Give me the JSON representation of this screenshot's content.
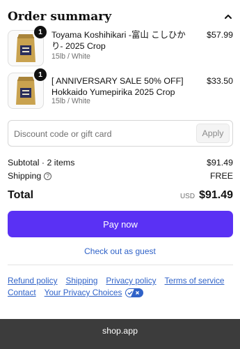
{
  "header": {
    "title": "Order summary",
    "collapse_icon": "chevron-up-icon"
  },
  "items": [
    {
      "name": "Toyama Koshihikari -富山 こしひかり- 2025 Crop",
      "variant": "15lb / White",
      "quantity": "1",
      "price": "$57.99",
      "image": "rice-bag-image"
    },
    {
      "name": "[ ANNIVERSARY SALE 50% OFF] Hokkaido Yumepirika 2025 Crop",
      "variant": "15lb / White",
      "quantity": "1",
      "price": "$33.50",
      "image": "rice-bag-image"
    }
  ],
  "discount": {
    "placeholder": "Discount code or gift card",
    "value": "",
    "apply_label": "Apply"
  },
  "summary": {
    "subtotal_label": "Subtotal · 2 items",
    "subtotal_value": "$91.49",
    "shipping_label": "Shipping",
    "shipping_value": "FREE",
    "total_label": "Total",
    "currency": "USD",
    "total_value": "$91.49"
  },
  "actions": {
    "pay_label": "Pay now",
    "guest_label": "Check out as guest"
  },
  "policies": {
    "refund": "Refund policy",
    "shipping": "Shipping",
    "privacy": "Privacy policy",
    "terms": "Terms of service",
    "contact": "Contact",
    "privacy_choices": "Your Privacy Choices"
  },
  "footer": {
    "text": "shop.app"
  },
  "colors": {
    "accent": "#5a31f4",
    "link": "#2f62c8",
    "footer": "#3c3c3c"
  }
}
